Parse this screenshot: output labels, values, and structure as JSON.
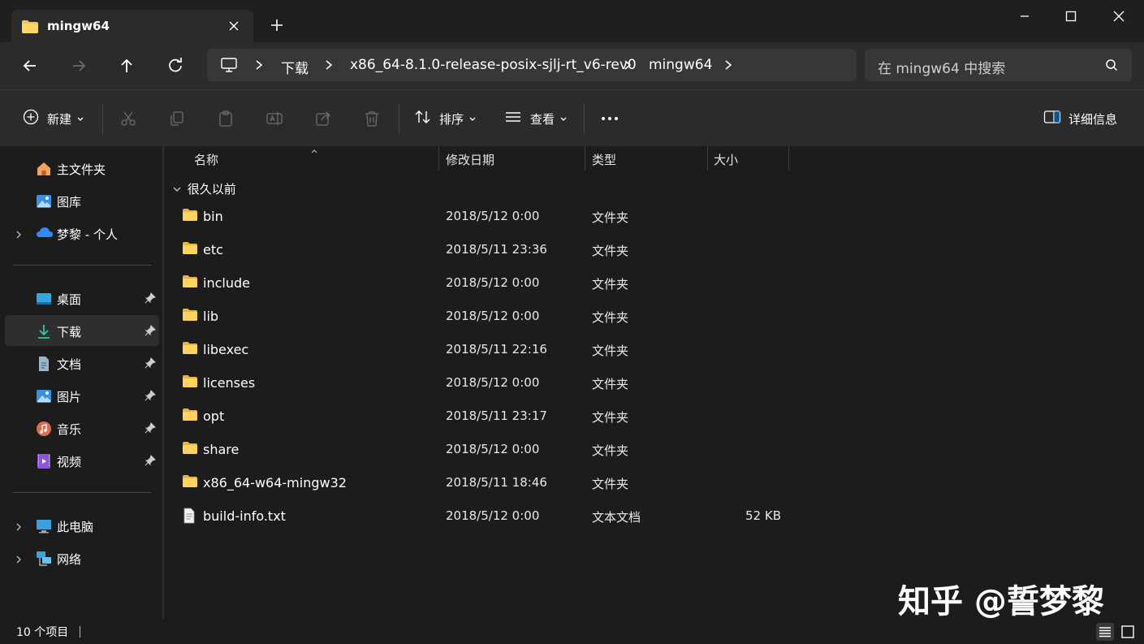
{
  "window": {
    "tab_title": "mingw64",
    "accent": "#0078d4",
    "folder_color": "#f6c543"
  },
  "address": {
    "crumbs": [
      "下载",
      "x86_64-8.1.0-release-posix-sjlj-rt_v6-rev0",
      "mingw64"
    ]
  },
  "search": {
    "placeholder": "在 mingw64 中搜索"
  },
  "toolbar": {
    "new_label": "新建",
    "sort_label": "排序",
    "view_label": "查看",
    "details_label": "详细信息",
    "icons": [
      "cut-icon",
      "copy-icon",
      "paste-icon",
      "rename-icon",
      "share-icon",
      "delete-icon"
    ]
  },
  "sidebar": {
    "home": "主文件夹",
    "gallery": "图库",
    "onedrive": "梦黎 - 个人",
    "desktop": "桌面",
    "downloads": "下载",
    "documents": "文档",
    "pictures": "图片",
    "music": "音乐",
    "videos": "视频",
    "thispc": "此电脑",
    "network": "网络"
  },
  "columns": {
    "name": "名称",
    "date": "修改日期",
    "type": "类型",
    "size": "大小"
  },
  "group_label": "很久以前",
  "files": [
    {
      "name": "bin",
      "date": "2018/5/12 0:00",
      "type": "文件夹",
      "size": "",
      "kind": "folder"
    },
    {
      "name": "etc",
      "date": "2018/5/11 23:36",
      "type": "文件夹",
      "size": "",
      "kind": "folder"
    },
    {
      "name": "include",
      "date": "2018/5/12 0:00",
      "type": "文件夹",
      "size": "",
      "kind": "folder"
    },
    {
      "name": "lib",
      "date": "2018/5/12 0:00",
      "type": "文件夹",
      "size": "",
      "kind": "folder"
    },
    {
      "name": "libexec",
      "date": "2018/5/11 22:16",
      "type": "文件夹",
      "size": "",
      "kind": "folder"
    },
    {
      "name": "licenses",
      "date": "2018/5/12 0:00",
      "type": "文件夹",
      "size": "",
      "kind": "folder"
    },
    {
      "name": "opt",
      "date": "2018/5/11 23:17",
      "type": "文件夹",
      "size": "",
      "kind": "folder"
    },
    {
      "name": "share",
      "date": "2018/5/12 0:00",
      "type": "文件夹",
      "size": "",
      "kind": "folder"
    },
    {
      "name": "x86_64-w64-mingw32",
      "date": "2018/5/11 18:46",
      "type": "文件夹",
      "size": "",
      "kind": "folder"
    },
    {
      "name": "build-info.txt",
      "date": "2018/5/12 0:00",
      "type": "文本文档",
      "size": "52 KB",
      "kind": "text-file"
    }
  ],
  "status": {
    "count": "10 个项目"
  },
  "watermark": "知乎 @誓梦黎"
}
